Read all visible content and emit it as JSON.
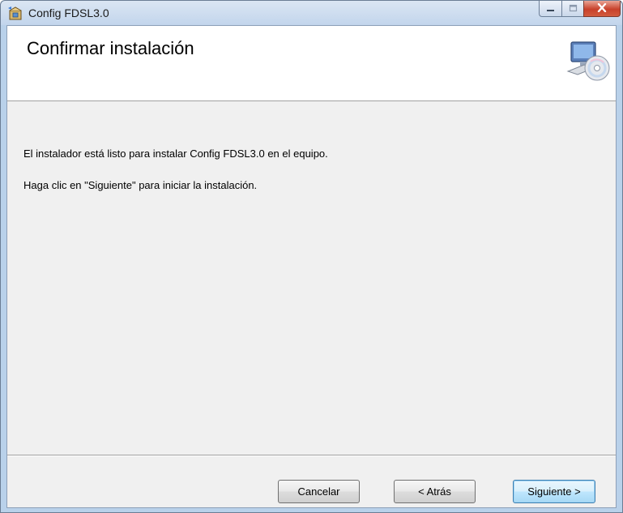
{
  "window": {
    "title": "Config FDSL3.0",
    "app_icon": "installer-package-icon",
    "controls": {
      "minimize_icon": "minimize-icon",
      "maximize_icon": "maximize-icon",
      "close_icon": "close-icon"
    }
  },
  "banner": {
    "heading": "Confirmar instalación",
    "icon": "computer-with-disc-icon"
  },
  "body": {
    "line1": "El instalador está listo para instalar Config FDSL3.0 en el equipo.",
    "line2": "Haga clic en \"Siguiente\" para iniciar la instalación."
  },
  "buttons": {
    "cancel": "Cancelar",
    "back": "< Atrás",
    "next": "Siguiente >"
  },
  "colors": {
    "titlebar": "#c2d5ec",
    "client_background": "#f0f0f0",
    "banner_background": "#ffffff",
    "close_button": "#c8412b",
    "default_button_border": "#3c7fb1"
  }
}
